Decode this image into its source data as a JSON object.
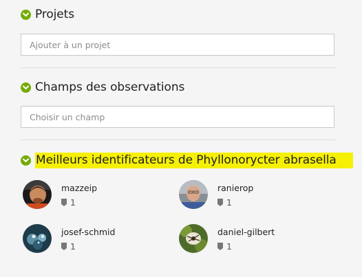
{
  "projects": {
    "title": "Projets",
    "placeholder": "Ajouter à un projet"
  },
  "fields": {
    "title": "Champs des observations",
    "placeholder": "Choisir un champ"
  },
  "identifiers": {
    "title": "Meilleurs identificateurs de Phyllonorycter abrasella",
    "users": [
      {
        "name": "mazzeip",
        "count": "1"
      },
      {
        "name": "ranierop",
        "count": "1"
      },
      {
        "name": "josef-schmid",
        "count": "1"
      },
      {
        "name": "daniel-gilbert",
        "count": "1"
      }
    ]
  },
  "colors": {
    "accent": "#74ac00",
    "highlight": "#f6f007"
  },
  "icons": {
    "section_toggle": "chevron-down-icon",
    "identification_count": "badge-icon"
  }
}
